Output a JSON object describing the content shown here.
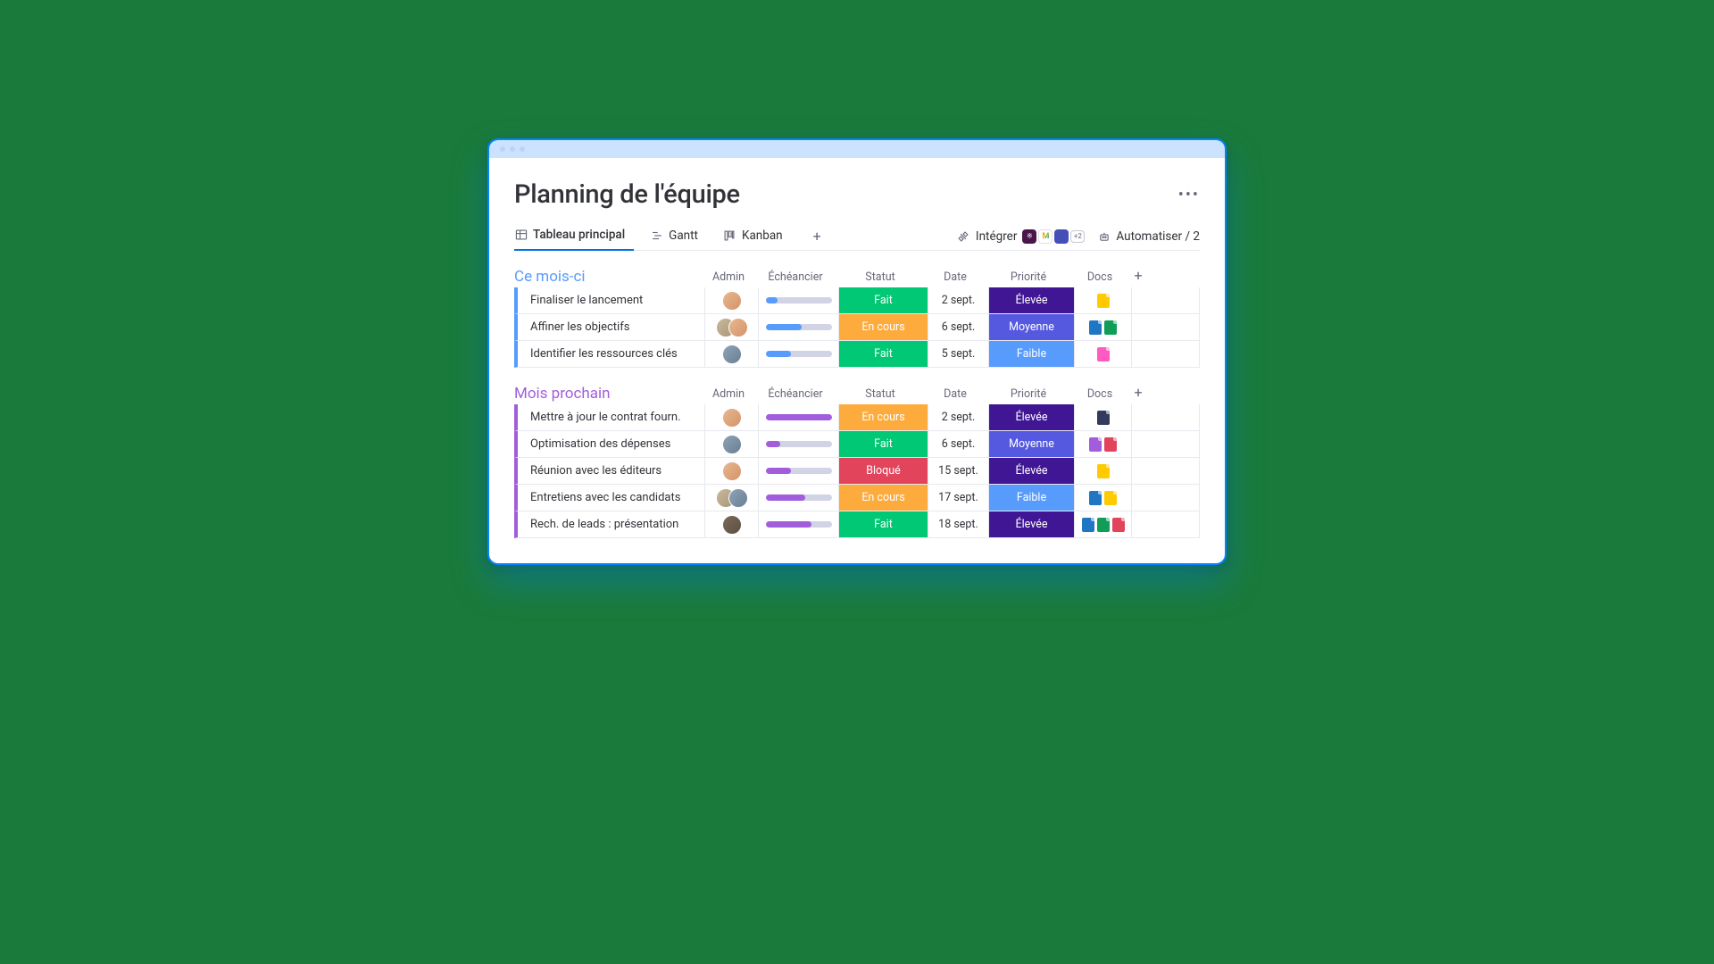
{
  "page_title": "Planning de l'équipe",
  "views": {
    "main": "Tableau principal",
    "gantt": "Gantt",
    "kanban": "Kanban"
  },
  "tools": {
    "integrate": "Intégrer",
    "integrate_more": "+2",
    "automate": "Automatiser / 2"
  },
  "columns": {
    "admin": "Admin",
    "timeline": "Échéancier",
    "status": "Statut",
    "date": "Date",
    "priority": "Priorité",
    "docs": "Docs"
  },
  "status_labels": {
    "done": "Fait",
    "working": "En cours",
    "blocked": "Bloqué"
  },
  "priority_labels": {
    "high": "Élevée",
    "medium": "Moyenne",
    "low": "Faible"
  },
  "groups": [
    {
      "title": "Ce mois-ci",
      "rows": [
        {
          "title": "Finaliser le lancement",
          "avatars": [
            "av1"
          ],
          "progress": 18,
          "status": "done",
          "date": "2 sept.",
          "priority": "high",
          "docs": [
            "yel"
          ]
        },
        {
          "title": "Affiner les objectifs",
          "avatars": [
            "av2",
            "av1"
          ],
          "progress": 55,
          "status": "working",
          "date": "6 sept.",
          "priority": "medium",
          "docs": [
            "blu",
            "grn"
          ]
        },
        {
          "title": "Identifier les ressources clés",
          "avatars": [
            "av3"
          ],
          "progress": 38,
          "status": "done",
          "date": "5 sept.",
          "priority": "low",
          "docs": [
            "pnk"
          ]
        }
      ]
    },
    {
      "title": "Mois prochain",
      "rows": [
        {
          "title": "Mettre à jour le contrat fourn.",
          "avatars": [
            "av1"
          ],
          "progress": 100,
          "status": "working",
          "date": "2 sept.",
          "priority": "high",
          "docs": [
            "nvy"
          ]
        },
        {
          "title": "Optimisation des dépenses",
          "avatars": [
            "av3"
          ],
          "progress": 22,
          "status": "done",
          "date": "6 sept.",
          "priority": "medium",
          "docs": [
            "pur",
            "red"
          ]
        },
        {
          "title": "Réunion avec les éditeurs",
          "avatars": [
            "av1"
          ],
          "progress": 38,
          "status": "blocked",
          "date": "15 sept.",
          "priority": "high",
          "docs": [
            "yel"
          ]
        },
        {
          "title": "Entretiens avec les candidats",
          "avatars": [
            "av2",
            "av3"
          ],
          "progress": 60,
          "status": "working",
          "date": "17 sept.",
          "priority": "low",
          "docs": [
            "blu",
            "yel"
          ]
        },
        {
          "title": "Rech. de leads : présentation",
          "avatars": [
            "av4"
          ],
          "progress": 70,
          "status": "done",
          "date": "18 sept.",
          "priority": "high",
          "docs": [
            "blu",
            "grn",
            "red"
          ]
        }
      ]
    }
  ]
}
